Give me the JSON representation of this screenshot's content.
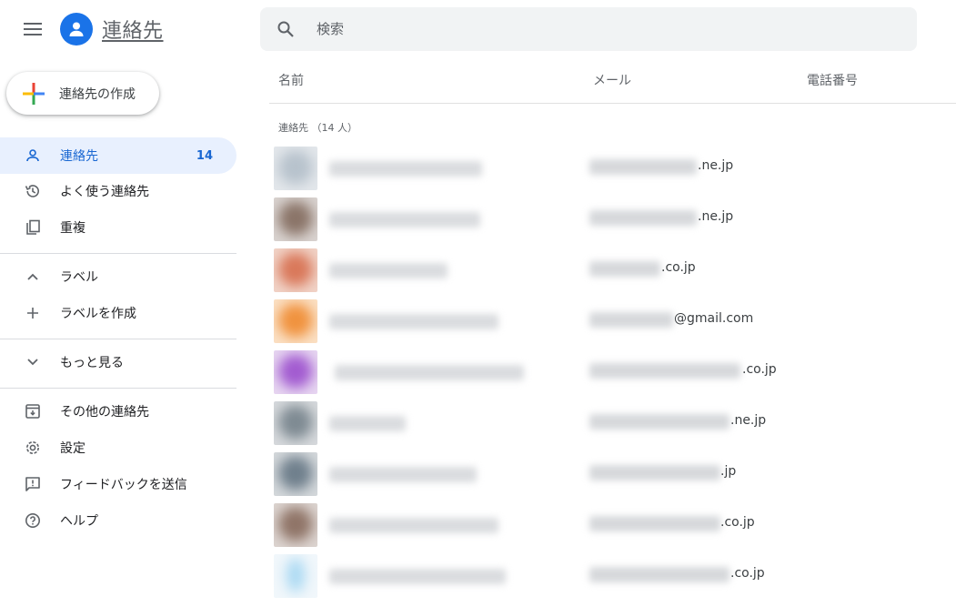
{
  "header": {
    "app_title": "連絡先",
    "menu_icon": "hamburger-menu-icon",
    "logo_icon": "person-circle-icon"
  },
  "create_button": {
    "label": "連絡先の作成"
  },
  "sidebar": {
    "items": [
      {
        "id": "contacts",
        "label": "連絡先",
        "count": "14",
        "icon": "person-icon",
        "active": true
      },
      {
        "id": "frequent",
        "label": "よく使う連絡先",
        "icon": "history-icon"
      },
      {
        "id": "duplicates",
        "label": "重複",
        "icon": "copy-icon"
      },
      {
        "id": "labels",
        "label": "ラベル",
        "icon": "chevron-up-icon"
      },
      {
        "id": "create-label",
        "label": "ラベルを作成",
        "icon": "plus-icon"
      },
      {
        "id": "more",
        "label": "もっと見る",
        "icon": "chevron-down-icon"
      },
      {
        "id": "other-contacts",
        "label": "その他の連絡先",
        "icon": "archive-icon"
      },
      {
        "id": "settings",
        "label": "設定",
        "icon": "gear-icon"
      },
      {
        "id": "feedback",
        "label": "フィードバックを送信",
        "icon": "feedback-icon"
      },
      {
        "id": "help",
        "label": "ヘルプ",
        "icon": "help-icon"
      }
    ]
  },
  "search": {
    "placeholder": "検索",
    "icon": "search-icon"
  },
  "table": {
    "columns": [
      "名前",
      "メール",
      "電話番号"
    ],
    "group_label": "連絡先 （14 人）",
    "rows": [
      {
        "email_domain": ".ne.jp"
      },
      {
        "email_domain": ".ne.jp"
      },
      {
        "email_domain": ".co.jp"
      },
      {
        "email_domain": "@gmail.com"
      },
      {
        "email_domain": ".co.jp"
      },
      {
        "email_domain": ".ne.jp"
      },
      {
        "email_domain": ".jp"
      },
      {
        "email_domain": ".co.jp"
      },
      {
        "email_domain": ".co.jp"
      }
    ]
  },
  "colors": {
    "accent_blue": "#1a73e8",
    "active_bg": "#e8f0fe",
    "active_text": "#1967d2",
    "search_bg": "#f1f3f4",
    "avatar_tints": [
      "#b7c2cc",
      "#8a7468",
      "#d9785a",
      "#f0923e",
      "#a25bd0",
      "#7e8a92",
      "#6f7f8c",
      "#8f7467",
      "#a8d8f2"
    ]
  }
}
